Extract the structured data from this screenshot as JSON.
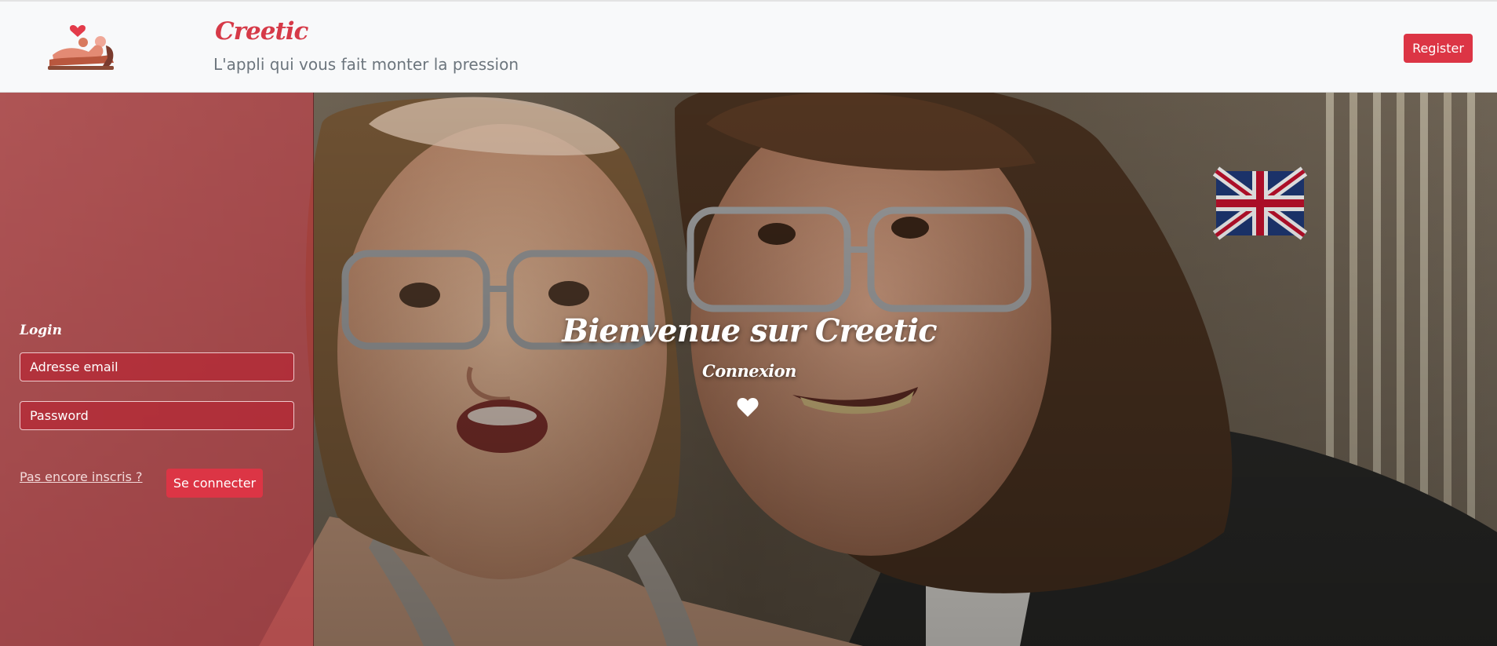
{
  "navbar": {
    "brand": "Creetic",
    "tagline": "L'appli qui vous fait monter la pression",
    "logo_icon": "couple-heart-logo",
    "register_label": "Register"
  },
  "login": {
    "title": "Login",
    "email_placeholder": "Adresse email",
    "password_placeholder": "Password",
    "signup_link": "Pas encore inscris ?",
    "submit_label": "Se connecter"
  },
  "hero": {
    "welcome": "Bienvenue sur Creetic",
    "subtitle": "Connexion",
    "icon": "heart-icon"
  },
  "colors": {
    "accent": "#dc3545",
    "brand": "#d63a48",
    "navbar_bg": "#f8f9fa",
    "muted_text": "#6c757d"
  }
}
